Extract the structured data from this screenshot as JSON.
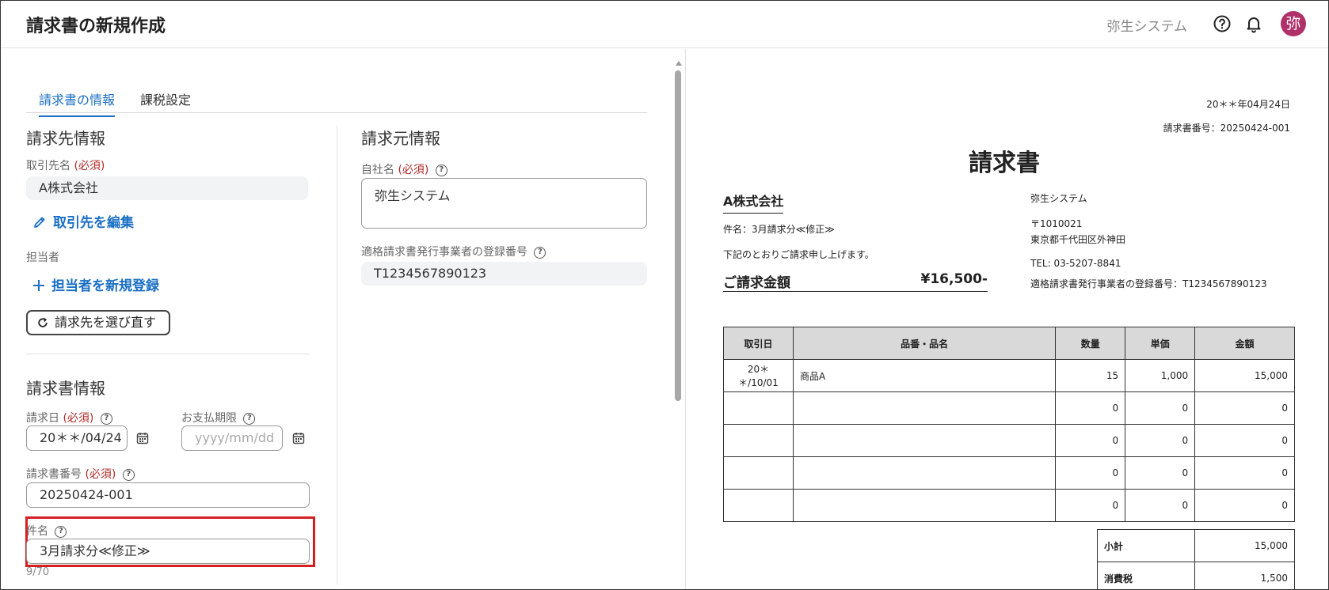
{
  "header": {
    "title": "請求書の新規作成",
    "company": "弥生システム",
    "avatar_initial": "弥",
    "avatar_color": "#b0306a"
  },
  "tabs": [
    {
      "label": "請求書の情報",
      "active": true
    },
    {
      "label": "課税設定",
      "active": false
    }
  ],
  "billing_to": {
    "section_title": "請求先情報",
    "client_label": "取引先名",
    "required": "(必須)",
    "client_value": "A株式会社",
    "edit_client_label": "取引先を編集",
    "contact_label": "担当者",
    "add_contact_label": "担当者を新規登録",
    "reselect_label": "請求先を選び直す"
  },
  "invoice_info": {
    "section_title": "請求書情報",
    "invoice_date_label": "請求日",
    "invoice_date_value": "20＊＊/04/24",
    "due_date_label": "お支払期限",
    "due_date_placeholder": "yyyy/mm/dd",
    "invoice_number_label": "請求書番号",
    "invoice_number_value": "20250424-001",
    "subject_label": "件名",
    "subject_value": "3月請求分≪修正≫",
    "subject_counter": "9/70"
  },
  "billing_from": {
    "section_title": "請求元情報",
    "own_name_label": "自社名",
    "own_name_value": "弥生システム",
    "registration_label": "適格請求書発行事業者の登録番号",
    "registration_value": "T1234567890123"
  },
  "preview": {
    "date": "20＊＊年04月24日",
    "number": "請求書番号：20250424-001",
    "title": "請求書",
    "client": "A株式会社",
    "subject": "件名：3月請求分≪修正≫",
    "message": "下記のとおりご請求申し上げます。",
    "amount_label": "ご請求金額",
    "amount_value": "¥16,500-",
    "issuer_name": "弥生システム",
    "issuer_postal": "〒1010021",
    "issuer_address": "東京都千代田区外神田",
    "issuer_tel": "TEL: 03-5207-8841",
    "issuer_registration": "適格請求書発行事業者の登録番号：T1234567890123",
    "table_headers": [
      "取引日",
      "品番・品名",
      "数量",
      "単価",
      "金額"
    ],
    "rows": [
      [
        "20＊＊/10/01",
        "商品A",
        "15",
        "1,000",
        "15,000"
      ],
      [
        "",
        "",
        "0",
        "0",
        "0"
      ],
      [
        "",
        "",
        "0",
        "0",
        "0"
      ],
      [
        "",
        "",
        "0",
        "0",
        "0"
      ],
      [
        "",
        "",
        "0",
        "0",
        "0"
      ]
    ],
    "totals": [
      {
        "label": "小計",
        "value": "15,000"
      },
      {
        "label": "消費税",
        "value": "1,500"
      }
    ]
  },
  "colors": {
    "accent": "#1a6fc4",
    "required": "#b02a2a",
    "highlight": "#d42020"
  }
}
